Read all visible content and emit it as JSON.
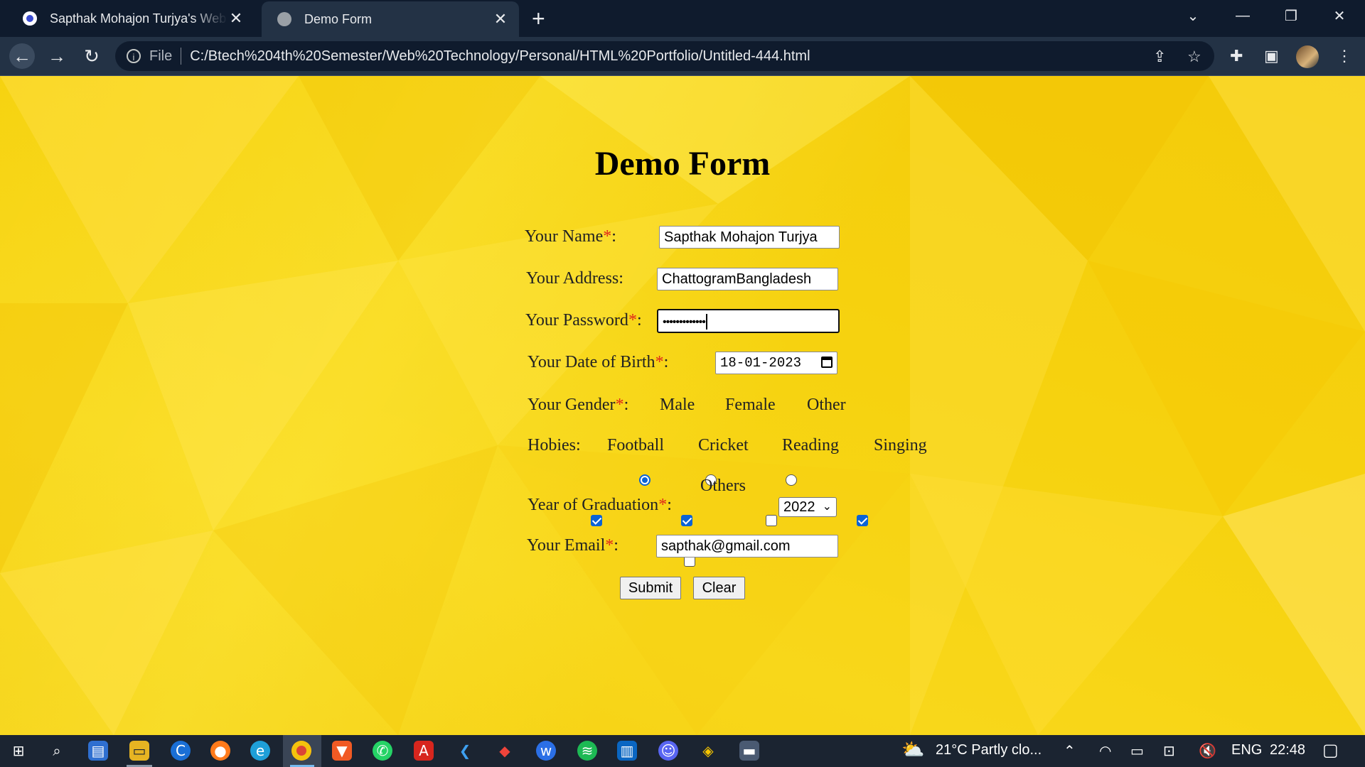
{
  "browser": {
    "tabs": [
      {
        "label": "Sapthak Mohajon Turjya's Webpage",
        "active": false
      },
      {
        "label": "Demo Form",
        "active": true
      }
    ],
    "new_tab": "+",
    "close_glyph": "✕",
    "address": {
      "scheme_label": "File",
      "url": "C:/Btech%204th%20Semester/Web%20Technology/Personal/HTML%20Portfolio/Untitled-444.html"
    },
    "icons": [
      "back-arrow-icon",
      "forward-arrow-icon",
      "reload-icon",
      "info-icon",
      "share-icon",
      "star-icon",
      "extensions-icon",
      "side-panel-icon",
      "profile-avatar",
      "menu-icon"
    ]
  },
  "form": {
    "title": "Demo Form",
    "required_mark": "*",
    "colon": ":",
    "name": {
      "label": "Your Name",
      "value": "Sapthak Mohajon Turjya"
    },
    "address": {
      "label": "Your Address:",
      "value": "ChattogramBangladesh"
    },
    "password": {
      "label": "Your Password",
      "value": "•••••••••••••"
    },
    "dob": {
      "label": "Your Date of Birth",
      "value": "18-01-2023"
    },
    "gender": {
      "label": "Your Gender",
      "options": [
        {
          "label": "Male",
          "checked": true
        },
        {
          "label": "Female",
          "checked": false
        },
        {
          "label": "Other",
          "checked": false
        }
      ]
    },
    "hobbies": {
      "label": "Hobies:",
      "options": [
        {
          "label": "Football",
          "checked": true
        },
        {
          "label": "Cricket",
          "checked": true
        },
        {
          "label": "Reading",
          "checked": false
        },
        {
          "label": "Singing",
          "checked": true
        },
        {
          "label": "Others",
          "checked": false
        }
      ]
    },
    "graduation": {
      "label": "Year of Graduation",
      "selected": "2022"
    },
    "email": {
      "label": "Your Email",
      "value": "sapthak@gmail.com"
    },
    "submit_label": "Submit",
    "clear_label": "Clear"
  },
  "taskbar": {
    "apps": [
      "windows-start-icon",
      "search-icon",
      "store-icon",
      "file-explorer-icon",
      "ccleaner-icon",
      "firefox-icon",
      "edge-icon",
      "chrome-icon",
      "brave-icon",
      "whatsapp-icon",
      "acrobat-icon",
      "vscode-icon",
      "anydesk-icon",
      "wps-icon",
      "spotify-icon",
      "trello-icon",
      "discord-icon",
      "git-icon",
      "remote-desktop-icon"
    ],
    "weather": "21°C  Partly clo...",
    "language": "ENG",
    "time": "22:48"
  },
  "colors": {
    "page_bg": "#f6d20f",
    "chrome_dark": "#0f1b2d",
    "required": "#e0261b",
    "accent": "#0b63d6"
  }
}
